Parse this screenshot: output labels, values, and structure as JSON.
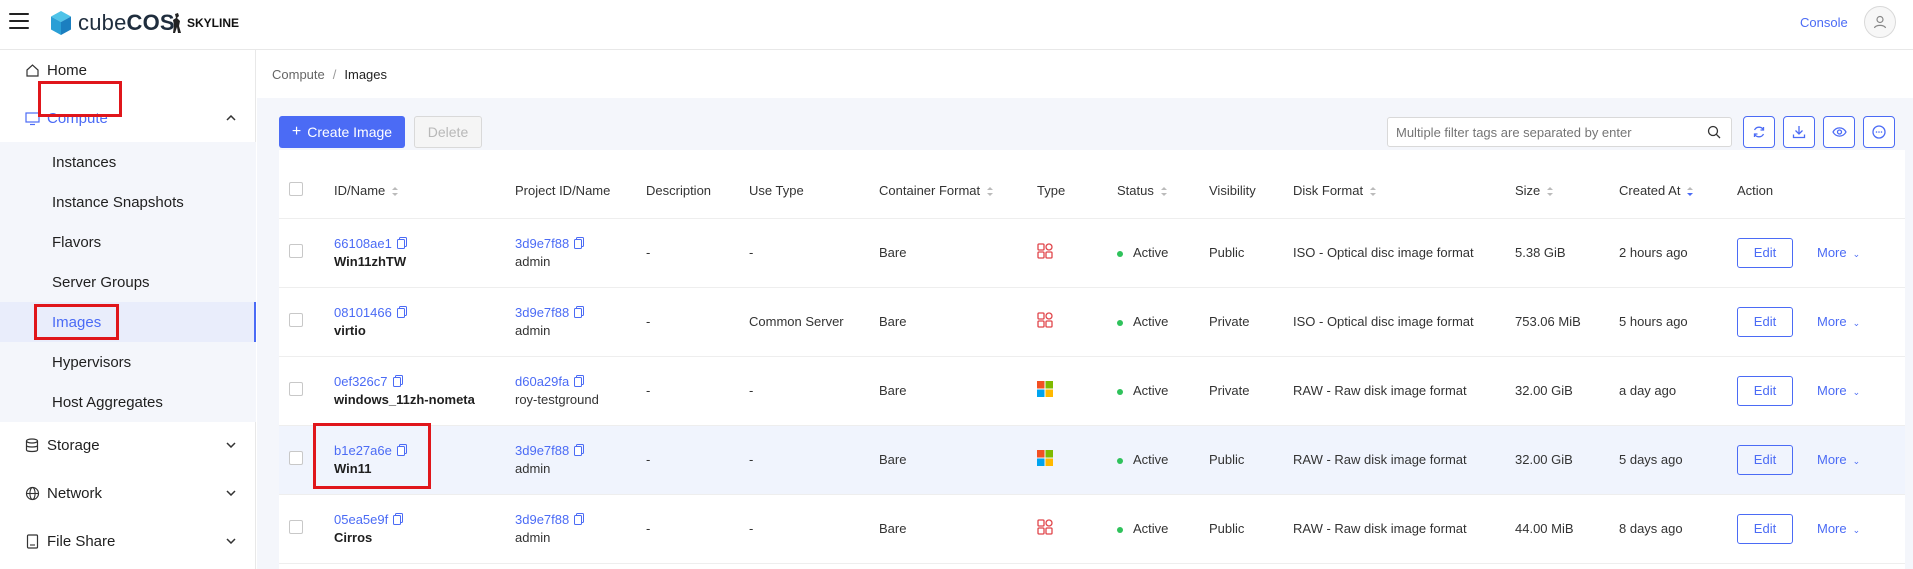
{
  "app": {
    "logo_text_light": "cube",
    "logo_text_bold": "COS",
    "partner": "SKYLINE",
    "console_label": "Console"
  },
  "sidebar": {
    "home": "Home",
    "compute": "Compute",
    "compute_items": [
      "Instances",
      "Instance Snapshots",
      "Flavors",
      "Server Groups",
      "Images",
      "Hypervisors",
      "Host Aggregates"
    ],
    "storage": "Storage",
    "network": "Network",
    "file_share": "File Share"
  },
  "breadcrumb": {
    "parent": "Compute",
    "sep": "/",
    "current": "Images"
  },
  "toolbar": {
    "create_label": "Create Image",
    "delete_label": "Delete",
    "search_placeholder": "Multiple filter tags are separated by enter"
  },
  "table": {
    "headers": {
      "id_name": "ID/Name",
      "project": "Project ID/Name",
      "description": "Description",
      "use_type": "Use Type",
      "container_format": "Container Format",
      "type": "Type",
      "status": "Status",
      "visibility": "Visibility",
      "disk_format": "Disk Format",
      "size": "Size",
      "created_at": "Created At",
      "action": "Action"
    },
    "edit_label": "Edit",
    "more_label": "More",
    "rows": [
      {
        "id": "66108ae1",
        "name": "Win11zhTW",
        "project_id": "3d9e7f88",
        "project_name": "admin",
        "description": "-",
        "use_type": "-",
        "container_format": "Bare",
        "type_icon": "generic-os-icon",
        "status": "Active",
        "visibility": "Public",
        "disk_format": "ISO - Optical disc image format",
        "size": "5.38 GiB",
        "created_at": "2 hours ago"
      },
      {
        "id": "08101466",
        "name": "virtio",
        "project_id": "3d9e7f88",
        "project_name": "admin",
        "description": "-",
        "use_type": "Common Server",
        "container_format": "Bare",
        "type_icon": "generic-os-icon",
        "status": "Active",
        "visibility": "Private",
        "disk_format": "ISO - Optical disc image format",
        "size": "753.06 MiB",
        "created_at": "5 hours ago"
      },
      {
        "id": "0ef326c7",
        "name": "windows_11zh-nometa",
        "project_id": "d60a29fa",
        "project_name": "roy-testground",
        "description": "-",
        "use_type": "-",
        "container_format": "Bare",
        "type_icon": "windows-icon",
        "status": "Active",
        "visibility": "Private",
        "disk_format": "RAW - Raw disk image format",
        "size": "32.00 GiB",
        "created_at": "a day ago"
      },
      {
        "id": "b1e27a6e",
        "name": "Win11",
        "project_id": "3d9e7f88",
        "project_name": "admin",
        "description": "-",
        "use_type": "-",
        "container_format": "Bare",
        "type_icon": "windows-icon",
        "status": "Active",
        "visibility": "Public",
        "disk_format": "RAW - Raw disk image format",
        "size": "32.00 GiB",
        "created_at": "5 days ago"
      },
      {
        "id": "05ea5e9f",
        "name": "Cirros",
        "project_id": "3d9e7f88",
        "project_name": "admin",
        "description": "-",
        "use_type": "-",
        "container_format": "Bare",
        "type_icon": "generic-os-icon",
        "status": "Active",
        "visibility": "Public",
        "disk_format": "RAW - Raw disk image format",
        "size": "44.00 MiB",
        "created_at": "8 days ago"
      }
    ]
  },
  "colors": {
    "accent": "#4b6bf5",
    "highlight_box": "#e0161b",
    "status_active": "#2fc25b"
  }
}
